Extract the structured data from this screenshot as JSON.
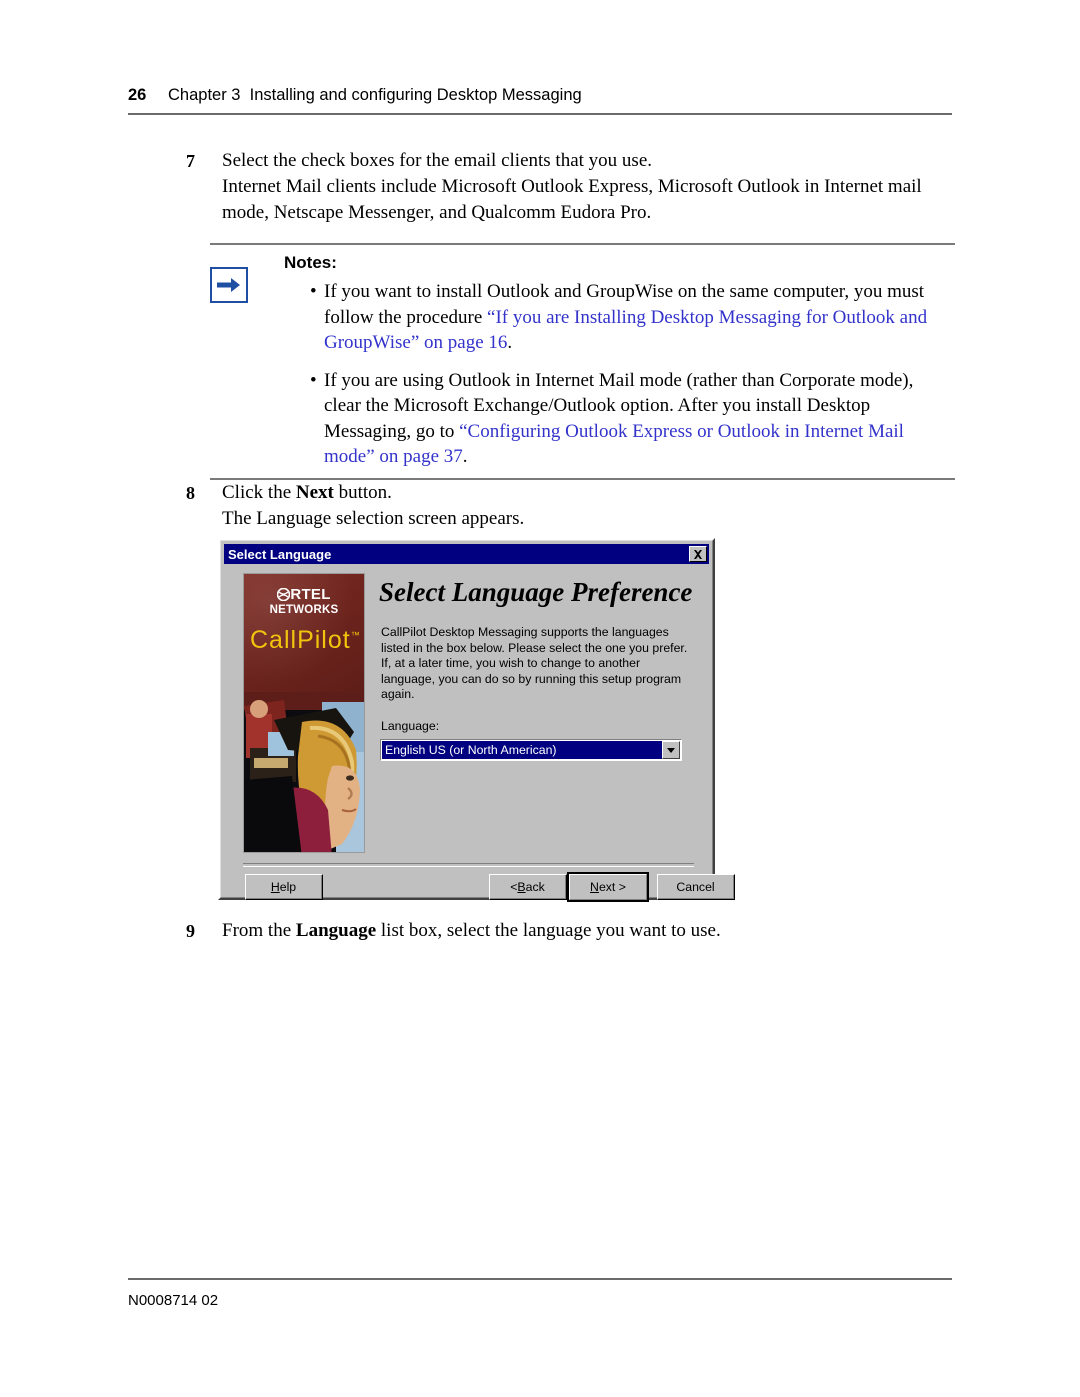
{
  "header": {
    "page_number": "26",
    "chapter": "Chapter 3",
    "chapter_title": "Installing and configuring Desktop Messaging"
  },
  "steps": {
    "step7": {
      "number": "7",
      "line1": "Select the check boxes for the email clients that you use.",
      "line2": "Internet Mail clients include Microsoft Outlook Express, Microsoft Outlook in Internet mail mode, Netscape Messenger, and Qualcomm Eudora Pro."
    },
    "step8": {
      "number": "8",
      "line1_pre": "Click the ",
      "line1_bold": "Next",
      "line1_post": " button.",
      "line2": "The Language selection screen appears."
    },
    "step9": {
      "number": "9",
      "line1_pre": "From the ",
      "line1_bold": "Language",
      "line1_post": " list box, select the language you want to use."
    }
  },
  "notes": {
    "title": "Notes:",
    "icon": "arrow-right-icon",
    "bullet": "•",
    "items": [
      {
        "pre": "If you want to install Outlook and GroupWise on the same computer, you must follow the procedure ",
        "link": "“If you are Installing Desktop Messaging for Outlook and GroupWise” on page 16",
        "post": "."
      },
      {
        "pre": "If you are using Outlook in Internet Mail mode (rather than Corporate mode), clear the Microsoft Exchange/Outlook option. After you install Desktop Messaging, go to ",
        "link": "“Configuring Outlook Express or Outlook in Internet Mail mode” on page 37",
        "post": "."
      }
    ],
    "link_color": "#3333cc"
  },
  "dialog": {
    "title": "Select Language",
    "close_icon": "close-icon",
    "logo": {
      "brand": "N",
      "brand_rest": "RTEL",
      "brand_sub": "NETWORKS",
      "product": "CallPilot",
      "trademark": "™",
      "panel_color": "#6d241d",
      "product_color": "#f2c40d"
    },
    "heading": "Select Language Preference",
    "description": "CallPilot Desktop Messaging supports the languages listed in the box below.  Please select the one you prefer.  If, at a later time,  you wish to change to another language, you can do so by running this setup program again.",
    "language_label": "Language:",
    "language_value": "English US (or North American)",
    "dropdown_icon": "chevron-down-icon",
    "buttons": [
      {
        "id": "help",
        "mnemonic": "H",
        "pre": "",
        "post": "elp"
      },
      {
        "id": "back",
        "mnemonic": "B",
        "pre": "< ",
        "post": "ack"
      },
      {
        "id": "next",
        "mnemonic": "N",
        "pre": "",
        "post": "ext >"
      },
      {
        "id": "cancel",
        "mnemonic": "",
        "pre": "Cancel",
        "post": ""
      }
    ]
  },
  "footer": {
    "doc_number": "N0008714 02"
  }
}
